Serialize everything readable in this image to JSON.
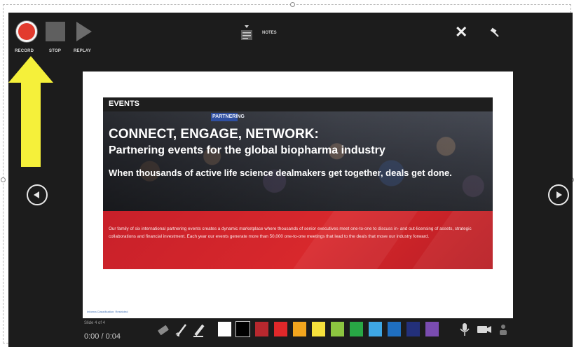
{
  "toolbar": {
    "record_label": "RECORD",
    "stop_label": "STOP",
    "replay_label": "REPLAY",
    "notes_label": "NOTES",
    "close_glyph": "✕"
  },
  "slide": {
    "section_header": "EVENTS",
    "photo_sign": "PARTNERING",
    "headline": "CONNECT, ENGAGE, NETWORK:",
    "subheadline": "Partnering events for the global biopharma industry",
    "tagline": "When thousands of active life science dealmakers get together, deals get done.",
    "description": "Our family of six international partnering events creates a dynamic marketplace where thousands of senior executives meet one-to-one to discuss in- and out-licensing of assets, strategic collaborations and financial investment. Each year our events generate more than 50,000 one-to-one meetings that lead to the deals that move our industry forward.",
    "footer_link": "Informa Classification: Restricted"
  },
  "status": {
    "slide_counter": "Slide 4 of 4",
    "time": "0:00 / 0:04"
  },
  "pen_colors": [
    "#ffffff",
    "#000000",
    "#b7282e",
    "#e0282a",
    "#f2a51e",
    "#f6e03c",
    "#8cc540",
    "#28a745",
    "#3ea7e4",
    "#1f6fc0",
    "#23307a",
    "#7a4cb0"
  ],
  "icons": {
    "record": "record-icon",
    "stop": "stop-icon",
    "replay": "replay-icon",
    "notes": "notes-icon",
    "close": "close-icon",
    "pin": "pin-icon",
    "prev": "previous-slide-icon",
    "next": "next-slide-icon",
    "eraser": "eraser-icon",
    "pen": "pen-icon",
    "highlighter": "highlighter-icon",
    "mic": "microphone-icon",
    "camera": "camera-icon",
    "camera_preview": "camera-preview-icon"
  },
  "annotation": {
    "arrow_color": "#f5f03a"
  }
}
